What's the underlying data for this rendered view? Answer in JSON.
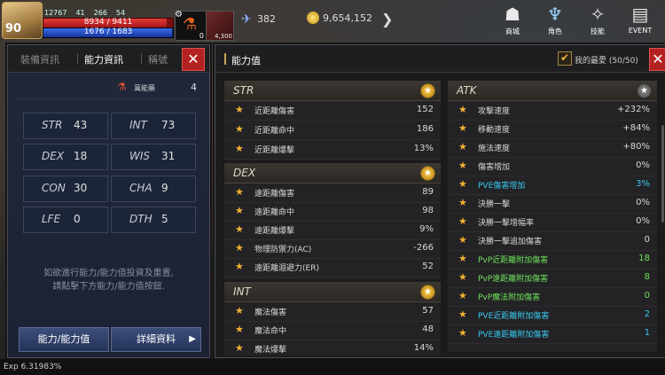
{
  "hud": {
    "level": "90",
    "mini_stats": [
      "12767",
      "41",
      "266",
      "54"
    ],
    "hp": "8934 / 9411",
    "hp_fraction": 0.949,
    "mp": "1676 / 1683",
    "mp_fraction": 0.996,
    "potion_count": "0",
    "skill_count": "4,300",
    "wing_value": "382",
    "gold": "9,654,152",
    "top_icons": [
      {
        "icon": "shop-icon",
        "label": "商城"
      },
      {
        "icon": "character-icon",
        "label": "角色"
      },
      {
        "icon": "skill-icon",
        "label": "技能"
      },
      {
        "icon": "event-icon",
        "label": "EVENT"
      }
    ]
  },
  "left_panel": {
    "tabs": [
      "裝備資訊",
      "能力資訊",
      "稱號"
    ],
    "elixir_label": "萬能藥",
    "elixir_value": "4",
    "stats": [
      {
        "name": "STR",
        "value": "43"
      },
      {
        "name": "INT",
        "value": "73"
      },
      {
        "name": "DEX",
        "value": "18"
      },
      {
        "name": "WIS",
        "value": "31"
      },
      {
        "name": "CON",
        "value": "30"
      },
      {
        "name": "CHA",
        "value": "9"
      },
      {
        "name": "LFE",
        "value": "0"
      },
      {
        "name": "DTH",
        "value": "5"
      }
    ],
    "hint_line1": "如欲進行能力/能力值投資及重置,",
    "hint_line2": "請點擊下方能力/能力值按鈕.",
    "btn_ability": "能力/能力值",
    "btn_detail": "詳細資料"
  },
  "right_panel": {
    "title": "能力值",
    "favorites_label": "我的最愛 (50/50)",
    "sections": {
      "str": {
        "title": "STR",
        "rows": [
          {
            "name": "近距離傷害",
            "value": "152"
          },
          {
            "name": "近距離命中",
            "value": "186"
          },
          {
            "name": "近距離爆擊",
            "value": "13%"
          }
        ]
      },
      "dex": {
        "title": "DEX",
        "rows": [
          {
            "name": "遠距離傷害",
            "value": "89"
          },
          {
            "name": "遠距離命中",
            "value": "98"
          },
          {
            "name": "遠距離爆擊",
            "value": "9%"
          },
          {
            "name": "物理防禦力(AC)",
            "value": "-266"
          },
          {
            "name": "遠距離迴避力(ER)",
            "value": "52"
          }
        ]
      },
      "int": {
        "title": "INT",
        "rows": [
          {
            "name": "魔法傷害",
            "value": "57"
          },
          {
            "name": "魔法命中",
            "value": "48"
          },
          {
            "name": "魔法爆擊",
            "value": "14%"
          }
        ]
      },
      "atk": {
        "title": "ATK",
        "rows": [
          {
            "name": "攻擊速度",
            "value": "+232%"
          },
          {
            "name": "移動速度",
            "value": "+84%"
          },
          {
            "name": "施法速度",
            "value": "+80%"
          },
          {
            "name": "傷害增加",
            "value": "0%"
          },
          {
            "name": "PVE傷害增加",
            "value": "3%"
          },
          {
            "name": "決勝一擊",
            "value": "0%"
          },
          {
            "name": "決勝一擊增幅率",
            "value": "0%"
          },
          {
            "name": "決勝一擊追加傷害",
            "value": "0"
          },
          {
            "name": "PvP近距離附加傷害",
            "value": "18"
          },
          {
            "name": "PvP遠距離附加傷害",
            "value": "8"
          },
          {
            "name": "PvP魔法附加傷害",
            "value": "0"
          },
          {
            "name": "PVE近距離附加傷害",
            "value": "2"
          },
          {
            "name": "PVE遠距離附加傷害",
            "value": "1"
          }
        ]
      }
    }
  },
  "footer": {
    "exp": "Exp 6.31983%"
  },
  "colors": {
    "accent_gold": "#f2b233",
    "close_red": "#b32222",
    "cyan": "#38c9f0",
    "green": "#6ee05a"
  }
}
